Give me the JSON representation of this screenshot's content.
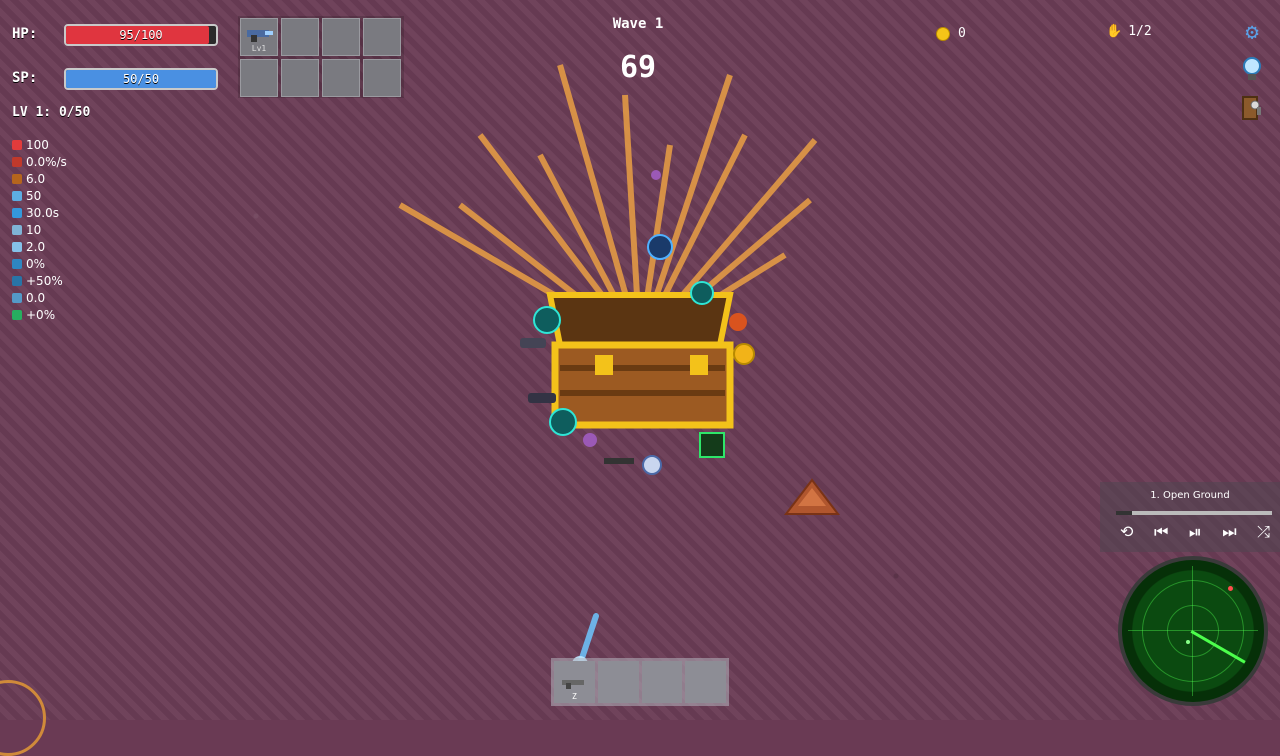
{
  "hud": {
    "hp_label": "HP:",
    "hp_value": "95/100",
    "hp_ratio": 0.95,
    "sp_label": "SP:",
    "sp_value": "50/50",
    "sp_ratio": 1.0,
    "level_text": "LV 1: 0/50"
  },
  "stats": [
    {
      "icon": "heart-icon",
      "color": "#e23b3b",
      "value": "100"
    },
    {
      "icon": "regen-icon",
      "color": "#c0392b",
      "value": "0.0%/s"
    },
    {
      "icon": "damage-icon",
      "color": "#b5651d",
      "value": "6.0"
    },
    {
      "icon": "shield-icon",
      "color": "#5dade2",
      "value": "50"
    },
    {
      "icon": "shield-regen-icon",
      "color": "#3498db",
      "value": "30.0s"
    },
    {
      "icon": "sword-icon",
      "color": "#7fb3d5",
      "value": "10"
    },
    {
      "icon": "speed-icon",
      "color": "#85c1e9",
      "value": "2.0"
    },
    {
      "icon": "crit-icon",
      "color": "#2e86c1",
      "value": "0%"
    },
    {
      "icon": "crit-damage-icon",
      "color": "#2874a6",
      "value": "+50%"
    },
    {
      "icon": "armor-icon",
      "color": "#5499c7",
      "value": "0.0"
    },
    {
      "icon": "bug-icon",
      "color": "#27ae60",
      "value": "+0%"
    }
  ],
  "inventory": {
    "slots": 8,
    "first_slot_level": "Lv1"
  },
  "wave": {
    "label": "Wave 1",
    "countdown": "69"
  },
  "coins": "0",
  "hands": "1/2",
  "music": {
    "track": "1. Open Ground",
    "progress": 0.1
  },
  "hotbar": {
    "slots": 4,
    "first_key": "Z"
  },
  "colors": {
    "hp": "#e0353f",
    "sp": "#4a90e2",
    "ground": "#6b3d56",
    "gold": "#f5c518",
    "radar": "#0b4a10"
  }
}
